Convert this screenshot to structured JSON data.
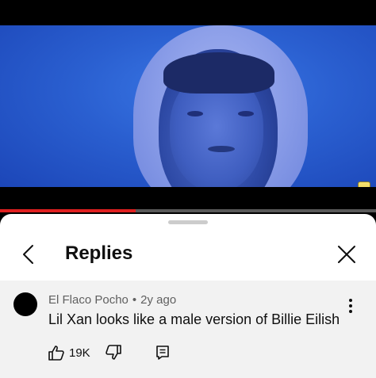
{
  "video": {
    "progress_percent": 36
  },
  "sheet": {
    "title": "Replies"
  },
  "comment": {
    "author": "El Flaco Pocho",
    "separator": "•",
    "age": "2y ago",
    "text": "Lil Xan looks like a male version of Billie Eilish",
    "like_count": "19K"
  },
  "colors": {
    "progress": "#e02020",
    "sheet_bg": "#ffffff",
    "comment_bg": "#f2f2f2",
    "meta_text": "#606060"
  },
  "icons": [
    "back-arrow-icon",
    "close-icon",
    "more-vert-icon",
    "thumbs-up-icon",
    "thumbs-down-icon",
    "comment-reply-icon"
  ]
}
